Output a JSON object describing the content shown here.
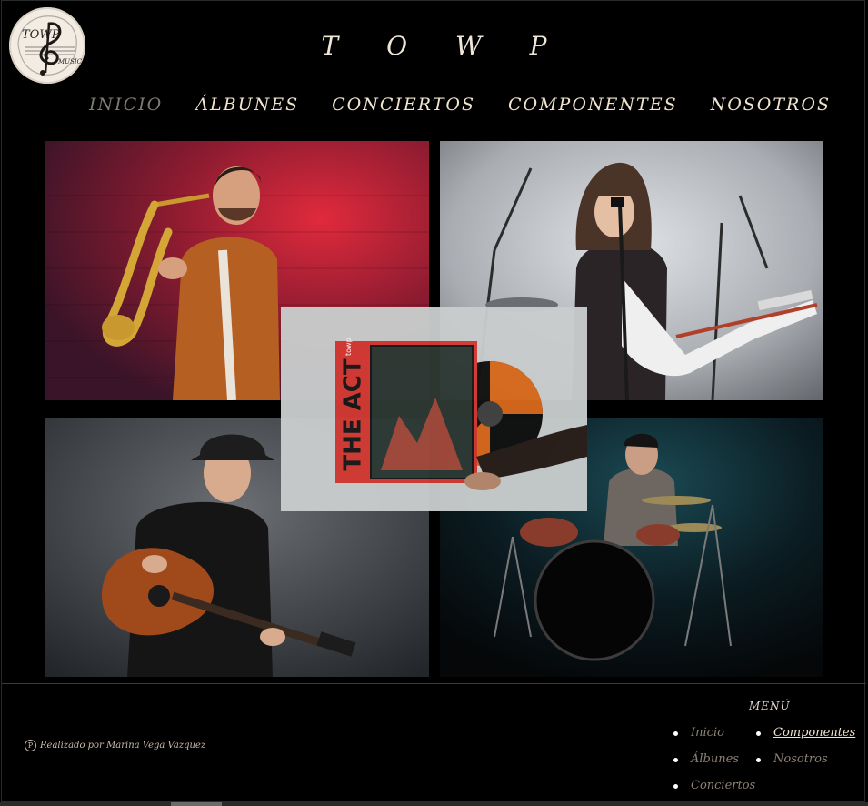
{
  "header": {
    "logo_icon": "treble-clef-logo-icon",
    "logo_text": "TOWP",
    "logo_sub": "MUSIC",
    "brand": "T O W P"
  },
  "nav": {
    "items": [
      {
        "label": "INICIO",
        "active": true
      },
      {
        "label": "ÁLBUNES",
        "active": false
      },
      {
        "label": "CONCIERTOS",
        "active": false
      },
      {
        "label": "COMPONENTES",
        "active": false
      },
      {
        "label": "NOSOTROS",
        "active": false
      }
    ]
  },
  "gallery": {
    "tiles": [
      {
        "icon": "saxophone-player-photo"
      },
      {
        "icon": "singer-guitarist-photo"
      },
      {
        "icon": "acoustic-guitarist-photo"
      },
      {
        "icon": "drummer-photo"
      }
    ],
    "overlay": {
      "album_title": "THE ACT",
      "album_band": "towp",
      "icon": "vinyl-record-icon"
    }
  },
  "footer": {
    "credit": "Realizado por Marina Vega Vazquez",
    "credit_icon": "p-circle-icon",
    "menu_title": "MENÚ",
    "menu_col1": [
      "Inicio",
      "Álbunes",
      "Conciertos"
    ],
    "menu_col2": [
      "Componentes",
      "Nosotros"
    ]
  },
  "colors": {
    "background": "#000000",
    "text": "#efe6d8",
    "active_nav": "#7f7a73"
  }
}
